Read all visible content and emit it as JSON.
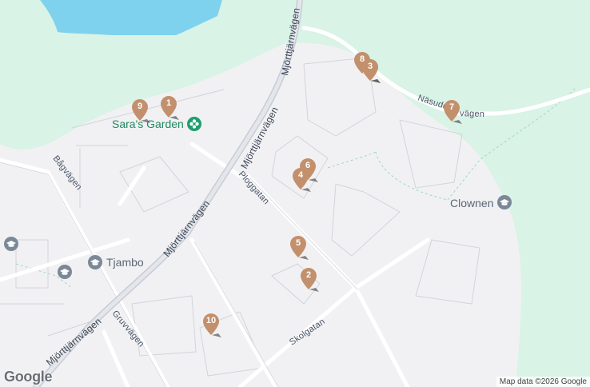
{
  "map": {
    "provider_logo": "Google",
    "attribution": "Map data ©2026 Google",
    "colors": {
      "land": "#f1f1f3",
      "park": "#d9f3e6",
      "water": "#7ed2ee",
      "road": "#ffffff",
      "road_outline": "#d2d4db",
      "highway": "#c7ccd6",
      "marker": "#c2906c",
      "poi_green": "#1f9e6e",
      "poi_grey": "#7b8897",
      "poi_text_green": "#1f8a61",
      "poi_text_grey": "#5b6676"
    }
  },
  "streets": [
    {
      "name": "Mjörttjärnvägen",
      "key": "mjorttjarnvagen-north"
    },
    {
      "name": "Mjörttjärnvägen",
      "key": "mjorttjarnvagen-mid"
    },
    {
      "name": "Mjörttjärnvägen",
      "key": "mjorttjarnvagen-south"
    },
    {
      "name": "Mjörttjärnvägen",
      "key": "mjorttjarnvagen-southwest"
    },
    {
      "name": "Bågvägen",
      "key": "bagvagen"
    },
    {
      "name": "Ploggatan",
      "key": "ploggatan"
    },
    {
      "name": "Skolgatan",
      "key": "skolgatan"
    },
    {
      "name": "Gruvvägen",
      "key": "gruvvagen"
    },
    {
      "name": "Näsudd",
      "key": "nasudd"
    },
    {
      "name": "vägen",
      "key": "nasudd-tail"
    }
  ],
  "pois": [
    {
      "name": "Sara's Garden",
      "icon": "flower-icon",
      "kind": "garden"
    },
    {
      "name": "Clownen",
      "icon": "school-icon",
      "kind": "school"
    },
    {
      "name": "Tjambo",
      "icon": "school-icon",
      "kind": "school"
    },
    {
      "name": "",
      "icon": "school-icon",
      "kind": "school"
    }
  ],
  "markers": [
    "1",
    "2",
    "3",
    "4",
    "5",
    "6",
    "7",
    "8",
    "9",
    "10"
  ]
}
